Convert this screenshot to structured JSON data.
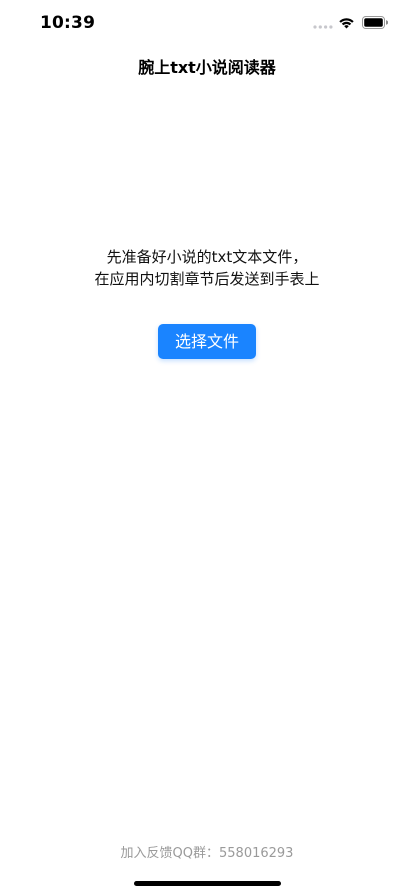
{
  "status_bar": {
    "time": "10:39",
    "signal_icon": "signal-dots-icon",
    "wifi_icon": "wifi-icon",
    "battery_icon": "battery-icon"
  },
  "nav": {
    "title": "腕上txt小说阅读器"
  },
  "main": {
    "intro_line_1": "先准备好小说的txt文本文件，",
    "intro_line_2": "在应用内切割章节后发送到手表上",
    "choose_file_label": "选择文件"
  },
  "footer": {
    "feedback": "加入反馈QQ群：558016293"
  },
  "colors": {
    "accent": "#1a84ff",
    "footer_text": "#9a9a9a",
    "background": "#ffffff"
  }
}
